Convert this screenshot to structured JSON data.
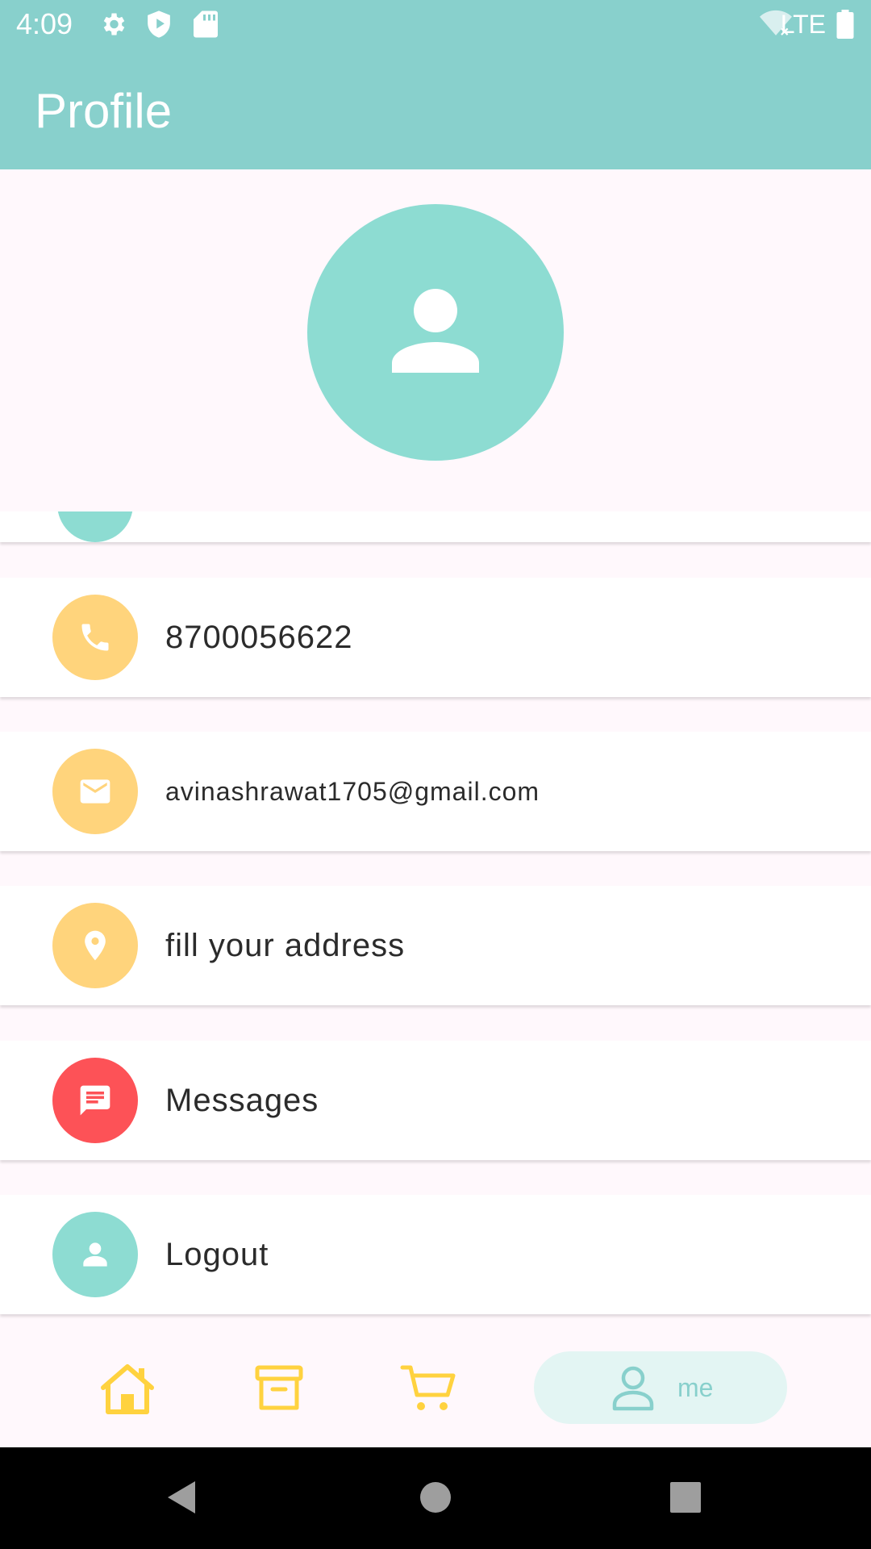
{
  "status_bar": {
    "time": "4:09",
    "network": "LTE",
    "icons": [
      "settings-icon",
      "shield-play-icon",
      "sd-card-icon",
      "wifi-off-icon",
      "battery-icon"
    ]
  },
  "app_bar": {
    "title": "Profile"
  },
  "profile": {
    "avatar_icon": "person-icon"
  },
  "rows": [
    {
      "icon": "phone-icon",
      "text": "8700056622",
      "color": "#ffd47c"
    },
    {
      "icon": "email-icon",
      "text": "avinashrawat1705@gmail.com",
      "color": "#ffd47c"
    },
    {
      "icon": "location-pin-icon",
      "text": "fill your address",
      "color": "#ffd47c"
    },
    {
      "icon": "message-icon",
      "text": "Messages",
      "color": "#fd5257"
    },
    {
      "icon": "person-icon",
      "text": "Logout",
      "color": "#8ddcd2"
    }
  ],
  "bottom_nav": {
    "items": [
      {
        "icon": "home-icon",
        "label": ""
      },
      {
        "icon": "archive-icon",
        "label": ""
      },
      {
        "icon": "cart-icon",
        "label": ""
      },
      {
        "icon": "person-outline-icon",
        "label": "me",
        "active": true
      }
    ],
    "accent": "#ffd23f",
    "active_color": "#88d0cc"
  },
  "system_nav": {
    "buttons": [
      "back-icon",
      "home-circle-icon",
      "recents-icon"
    ]
  }
}
